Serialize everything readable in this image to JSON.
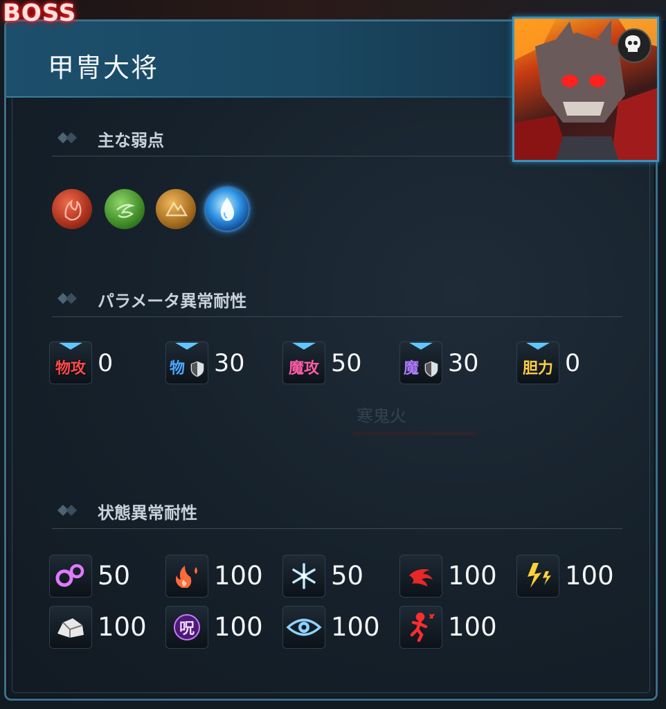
{
  "boss_label": "BOSS",
  "enemy": {
    "name": "甲冑大将",
    "portrait_icon": "demon-samurai-portrait",
    "badge_icon": "skull-icon"
  },
  "weakness": {
    "title": "主な弱点",
    "elements": [
      {
        "name": "fire",
        "icon": "fire-orb-icon",
        "highlighted": false
      },
      {
        "name": "wind",
        "icon": "wind-orb-icon",
        "highlighted": false
      },
      {
        "name": "earth",
        "icon": "earth-orb-icon",
        "highlighted": false
      },
      {
        "name": "water",
        "icon": "water-orb-icon",
        "highlighted": true
      }
    ]
  },
  "parameter_resistance": {
    "title": "パラメータ異常耐性",
    "items": [
      {
        "tag": "物攻",
        "value": "0",
        "color": "#ff4a4a",
        "icon": "phys-attack-icon"
      },
      {
        "tag": "物",
        "value": "30",
        "color": "#4aa8ff",
        "icon": "phys-defense-icon"
      },
      {
        "tag": "魔攻",
        "value": "50",
        "color": "#ff5aa8",
        "icon": "magic-attack-icon"
      },
      {
        "tag": "魔",
        "value": "30",
        "color": "#b07aff",
        "icon": "magic-defense-icon"
      },
      {
        "tag": "胆力",
        "value": "0",
        "color": "#ffcf40",
        "icon": "courage-icon"
      }
    ]
  },
  "status_resistance": {
    "title": "状態異常耐性",
    "items": [
      {
        "icon": "poison-rings-icon",
        "value": "50"
      },
      {
        "icon": "burn-icon",
        "value": "100"
      },
      {
        "icon": "freeze-icon",
        "value": "50"
      },
      {
        "icon": "bleed-icon",
        "value": "100"
      },
      {
        "icon": "lightning-icon",
        "value": "100"
      },
      {
        "icon": "petrify-icon",
        "value": "100"
      },
      {
        "icon": "curse-icon",
        "value": "100"
      },
      {
        "icon": "eye-icon",
        "value": "100"
      },
      {
        "icon": "stun-icon",
        "value": "100"
      }
    ]
  },
  "background_text": "寒鬼火"
}
